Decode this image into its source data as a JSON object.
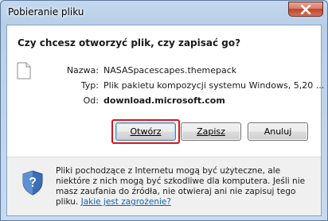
{
  "window": {
    "title": "Pobieranie pliku"
  },
  "dialog": {
    "question": "Czy chcesz otworzyć plik, czy zapisać go?",
    "fields": [
      {
        "label": "Nazwa:",
        "value": "NASASpacescapes.themepack",
        "bold": false
      },
      {
        "label": "Typ:",
        "value": "Plik pakietu kompozycji systemu Windows, 5,20 ...",
        "bold": false
      },
      {
        "label": "Od:",
        "value": "download.microsoft.com",
        "bold": true
      }
    ],
    "buttons": {
      "open_label": "Otwórz",
      "save_label": "Zapisz",
      "cancel_label": "Anuluj"
    },
    "warning": {
      "text": "Pliki pochodzące z Internetu mogą być użyteczne, ale niektóre z nich mogą być szkodliwe dla komputera. Jeśli nie masz zaufania do źródła, nie otwieraj ani nie zapisuj tego pliku.",
      "link": "Jakie jest zagrożenie?"
    }
  },
  "colors": {
    "highlight_outline": "#d9141a",
    "link": "#0b64b4",
    "close_button": "#c2432a"
  },
  "icons": {
    "close": "close-icon",
    "file": "file-icon",
    "shield": "security-shield-icon"
  }
}
